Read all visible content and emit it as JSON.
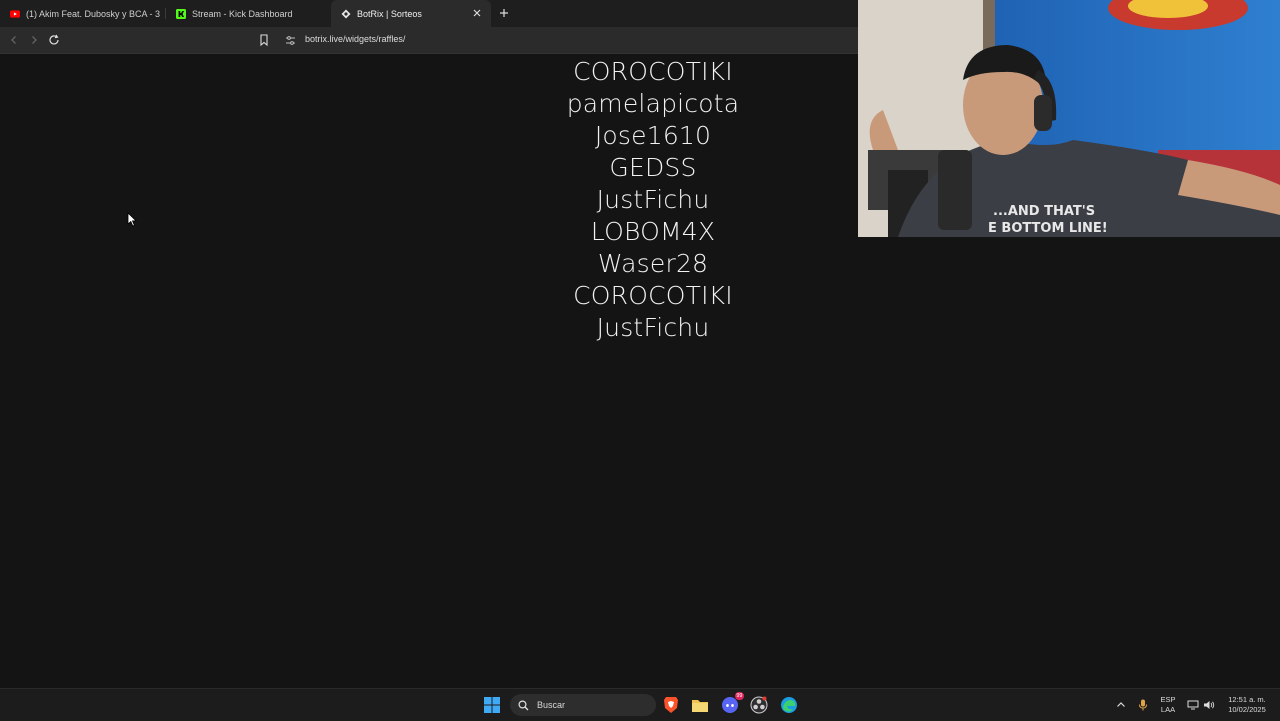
{
  "browser": {
    "tabs": [
      {
        "title": "(1) Akim Feat. Dubosky y BCA - 3 me",
        "icon": "youtube-icon",
        "active": false
      },
      {
        "title": "Stream - Kick Dashboard",
        "icon": "kick-icon",
        "active": false
      },
      {
        "title": "BotRix | Sorteos",
        "icon": "botrix-icon",
        "active": true
      }
    ],
    "url": "botrix.live/widgets/raffles/"
  },
  "raffle": {
    "entries": [
      "COROCOTIKI",
      "pamelapicota",
      "Jose1610",
      "GEDSS",
      "JustFichu",
      "LOBOM4X",
      "Waser28",
      "COROCOTIKI",
      "JustFichu"
    ]
  },
  "taskbar": {
    "search_label": "Buscar",
    "lang_line1": "ESP",
    "lang_line2": "LAA",
    "time": "12:51 a. m.",
    "date": "10/02/2025",
    "discord_badge": "99"
  },
  "colors": {
    "page_bg": "#141414",
    "tab_active": "#2b2b2b",
    "kick_green": "#53fc18",
    "youtube_red": "#ff0000"
  }
}
